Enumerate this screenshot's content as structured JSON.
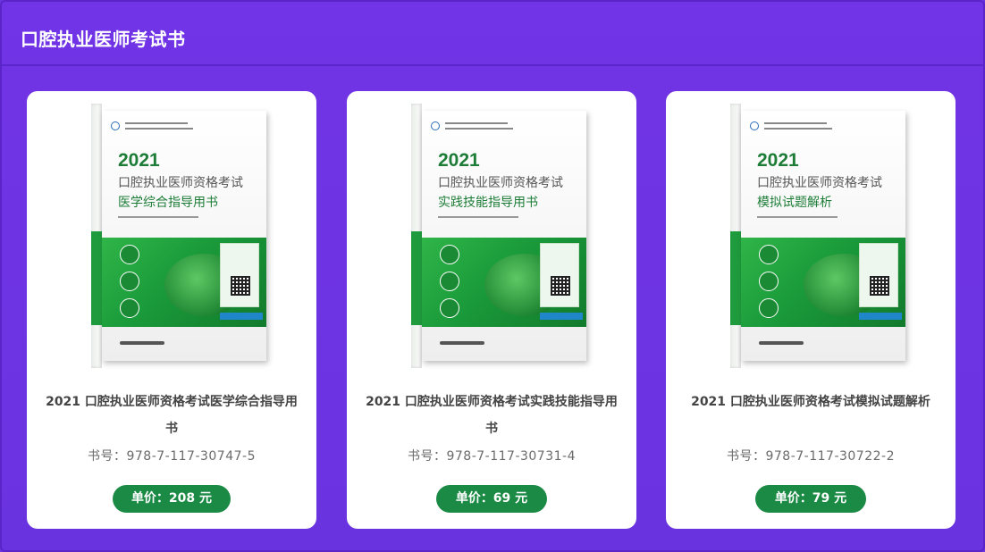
{
  "header": {
    "title": "口腔执业医师考试书"
  },
  "books": [
    {
      "cover_year": "2021",
      "cover_line1": "口腔执业医师资格考试",
      "cover_line2": "医学综合指导用书",
      "title": "2021 口腔执业医师资格考试医学综合指导用书",
      "isbn": "书号：978-7-117-30747-5",
      "price": "单价：208 元"
    },
    {
      "cover_year": "2021",
      "cover_line1": "口腔执业医师资格考试",
      "cover_line2": "实践技能指导用书",
      "title": "2021 口腔执业医师资格考试实践技能指导用书",
      "isbn": "书号：978-7-117-30731-4",
      "price": "单价：69 元"
    },
    {
      "cover_year": "2021",
      "cover_line1": "口腔执业医师资格考试",
      "cover_line2": "模拟试题解析",
      "title": "2021 口腔执业医师资格考试模拟试题解析",
      "isbn": "书号：978-7-117-30722-2",
      "price": "单价：79 元"
    }
  ],
  "colors": {
    "background": "#6c34e0",
    "card": "#ffffff",
    "price_badge": "#1b8a45",
    "cover_green": "#1d7d37"
  }
}
